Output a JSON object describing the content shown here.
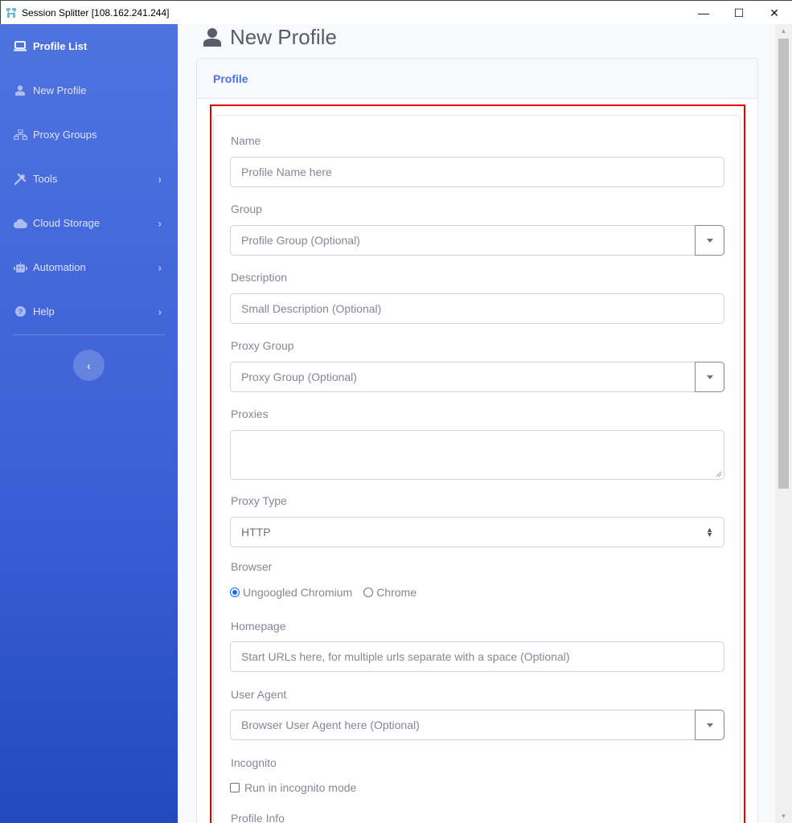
{
  "window": {
    "title": "Session Splitter [108.162.241.244]",
    "controls": {
      "minimize": "—",
      "maximize": "☐",
      "close": "✕"
    }
  },
  "sidebar": {
    "items": [
      {
        "label": "Profile List",
        "icon": "laptop-icon",
        "active": true,
        "has_submenu": false
      },
      {
        "label": "New Profile",
        "icon": "user-icon",
        "active": false,
        "has_submenu": false
      },
      {
        "label": "Proxy Groups",
        "icon": "network-icon",
        "active": false,
        "has_submenu": false
      },
      {
        "label": "Tools",
        "icon": "tools-icon",
        "active": false,
        "has_submenu": true
      },
      {
        "label": "Cloud Storage",
        "icon": "cloud-icon",
        "active": false,
        "has_submenu": true
      },
      {
        "label": "Automation",
        "icon": "robot-icon",
        "active": false,
        "has_submenu": true
      },
      {
        "label": "Help",
        "icon": "question-circle-icon",
        "active": false,
        "has_submenu": true
      }
    ],
    "chevron": "›",
    "toggle_label": "‹"
  },
  "page": {
    "heading": "New Profile",
    "card_header": "Profile"
  },
  "form": {
    "name": {
      "label": "Name",
      "placeholder": "Profile Name here"
    },
    "group": {
      "label": "Group",
      "placeholder": "Profile Group (Optional)"
    },
    "description": {
      "label": "Description",
      "placeholder": "Small Description (Optional)"
    },
    "proxy_group": {
      "label": "Proxy Group",
      "placeholder": "Proxy Group (Optional)"
    },
    "proxies": {
      "label": "Proxies",
      "value": ""
    },
    "proxy_type": {
      "label": "Proxy Type",
      "value": "HTTP"
    },
    "browser": {
      "label": "Browser",
      "options": [
        {
          "label": "Ungoogled Chromium",
          "selected": true
        },
        {
          "label": "Chrome",
          "selected": false
        }
      ]
    },
    "homepage": {
      "label": "Homepage",
      "placeholder": "Start URLs here, for multiple urls separate with a space (Optional)"
    },
    "user_agent": {
      "label": "User Agent",
      "placeholder": "Browser User Agent here (Optional)"
    },
    "incognito": {
      "label": "Incognito",
      "checkbox_label": "Run in incognito mode",
      "checked": false
    },
    "profile_info": {
      "label": "Profile Info"
    }
  },
  "colors": {
    "sidebar_primary": "#4e73df",
    "highlight_border": "#e60000",
    "header_text": "#4e73df"
  }
}
